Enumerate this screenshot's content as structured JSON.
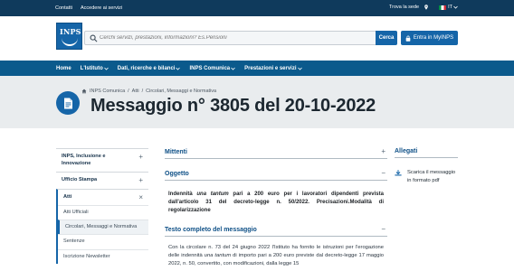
{
  "utility": {
    "links": [
      "Contatti",
      "Accedere ai servizi"
    ],
    "find_office": "Trova la sede",
    "language": "IT"
  },
  "header": {
    "logo_text": "INPS",
    "search_placeholder": "Cerchi servizi, prestazioni, informazioni? Es.Pensioni",
    "search_button": "Cerca",
    "login_button": "Entra in MyINPS"
  },
  "nav": {
    "items": [
      "Home",
      "L'Istituto",
      "Dati, ricerche e bilanci",
      "INPS Comunica",
      "Prestazioni e servizi"
    ]
  },
  "breadcrumb": [
    "INPS Comunica",
    "Atti",
    "Circolari, Messaggi e Normativa"
  ],
  "page": {
    "title": "Messaggio n° 3805 del 20-10-2022"
  },
  "sidebar": {
    "items": [
      {
        "label": "INPS, Inclusione e Innovazione",
        "toggle": "+"
      },
      {
        "label": "Ufficio Stampa",
        "toggle": "+"
      },
      {
        "label": "Atti",
        "toggle": "×"
      }
    ],
    "subitems": [
      "Atti Ufficiali",
      "Circolari, Messaggi e Normativa",
      "Sentenze",
      "Iscrizione Newsletter"
    ]
  },
  "main": {
    "sections": {
      "mittenti": {
        "title": "Mittenti",
        "toggle": "+"
      },
      "oggetto": {
        "title": "Oggetto",
        "toggle": "−"
      },
      "testo": {
        "title": "Testo completo del messaggio",
        "toggle": "−"
      }
    },
    "oggetto_parts": {
      "a": "Indennità ",
      "b": "una tantum",
      "c": " pari a 200 euro per i lavoratori dipendenti prevista dall'articolo 31 del decreto-legge n. 50/2022. Precisazioni.Modalità di regolarizzazione"
    },
    "body_parts": {
      "a": "Con la circolare n. 73 del 24 giugno 2022 l'Istituto ha fornito le istruzioni per l'erogazione delle indennità ",
      "b": "una tantum",
      "c": " di importo pari a 200 euro previste dal decreto-legge 17 maggio 2022, n. 50, convertito, con modificazioni, dalla legge 15"
    }
  },
  "aside": {
    "title": "Allegati",
    "attachment": "Scarica il messaggio in formato pdf"
  },
  "colors": {
    "utility_bg": "#0f3a5c",
    "nav_bg": "#0b5a8c",
    "accent": "#1565a8",
    "hero_bg": "#e9ecee"
  }
}
